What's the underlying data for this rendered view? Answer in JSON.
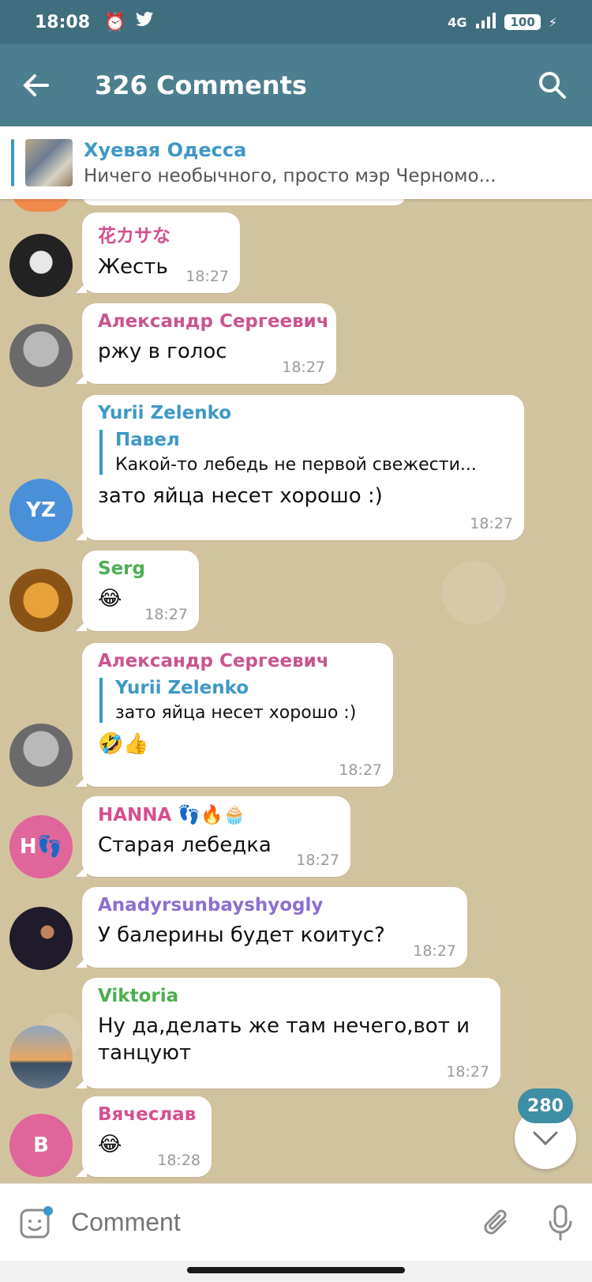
{
  "status_bar": {
    "time": "18:08",
    "network": "4G",
    "battery": "100"
  },
  "header": {
    "title": "326 Comments"
  },
  "pinned": {
    "title": "Хуевая Одесса",
    "text": "Ничего необычного, просто мэр Черномо..."
  },
  "messages": [
    {
      "author": "花カサな",
      "author_color": "#d64f8f",
      "text": "Жесть",
      "time": "18:27"
    },
    {
      "author": "Александр Сергеевич",
      "author_color": "#c9558f",
      "text": "ржу в голос",
      "time": "18:27"
    },
    {
      "author": "Yurii Zelenko",
      "author_color": "#3d98c6",
      "avatar_initials": "YZ",
      "reply_name": "Павел",
      "reply_text": "Какой-то лебедь не первой свежести...",
      "text": "зато яйца несет хорошо :)",
      "time": "18:27"
    },
    {
      "author": "Serg",
      "author_color": "#4caf50",
      "text": "😂",
      "time": "18:27"
    },
    {
      "author": "Александр Сергеевич",
      "author_color": "#c9558f",
      "reply_name": "Yurii Zelenko",
      "reply_text": "зато яйца несет хорошо :)",
      "text": "🤣👍",
      "time": "18:27"
    },
    {
      "author": "HANNA 👣🔥🧁",
      "author_color": "#d64f8f",
      "avatar_initials": "H👣",
      "text": "Старая лебедка",
      "time": "18:27"
    },
    {
      "author": "Anadyrsunbayshyogly",
      "author_color": "#8c6fd0",
      "text": "У балерины будет коитус?",
      "time": "18:27"
    },
    {
      "author": "Viktoria",
      "author_color": "#4caf50",
      "text": "Ну да,делать же там нечего,вот и танцуют",
      "time": "18:27"
    },
    {
      "author": "Вячеслав",
      "author_color": "#d64f8f",
      "avatar_initials": "В",
      "text": "😂",
      "time": "18:28"
    }
  ],
  "unread_count": "280",
  "composer": {
    "placeholder": "Comment"
  },
  "colors": {
    "header": "#4b7e8e",
    "accent": "#3d98c6"
  }
}
